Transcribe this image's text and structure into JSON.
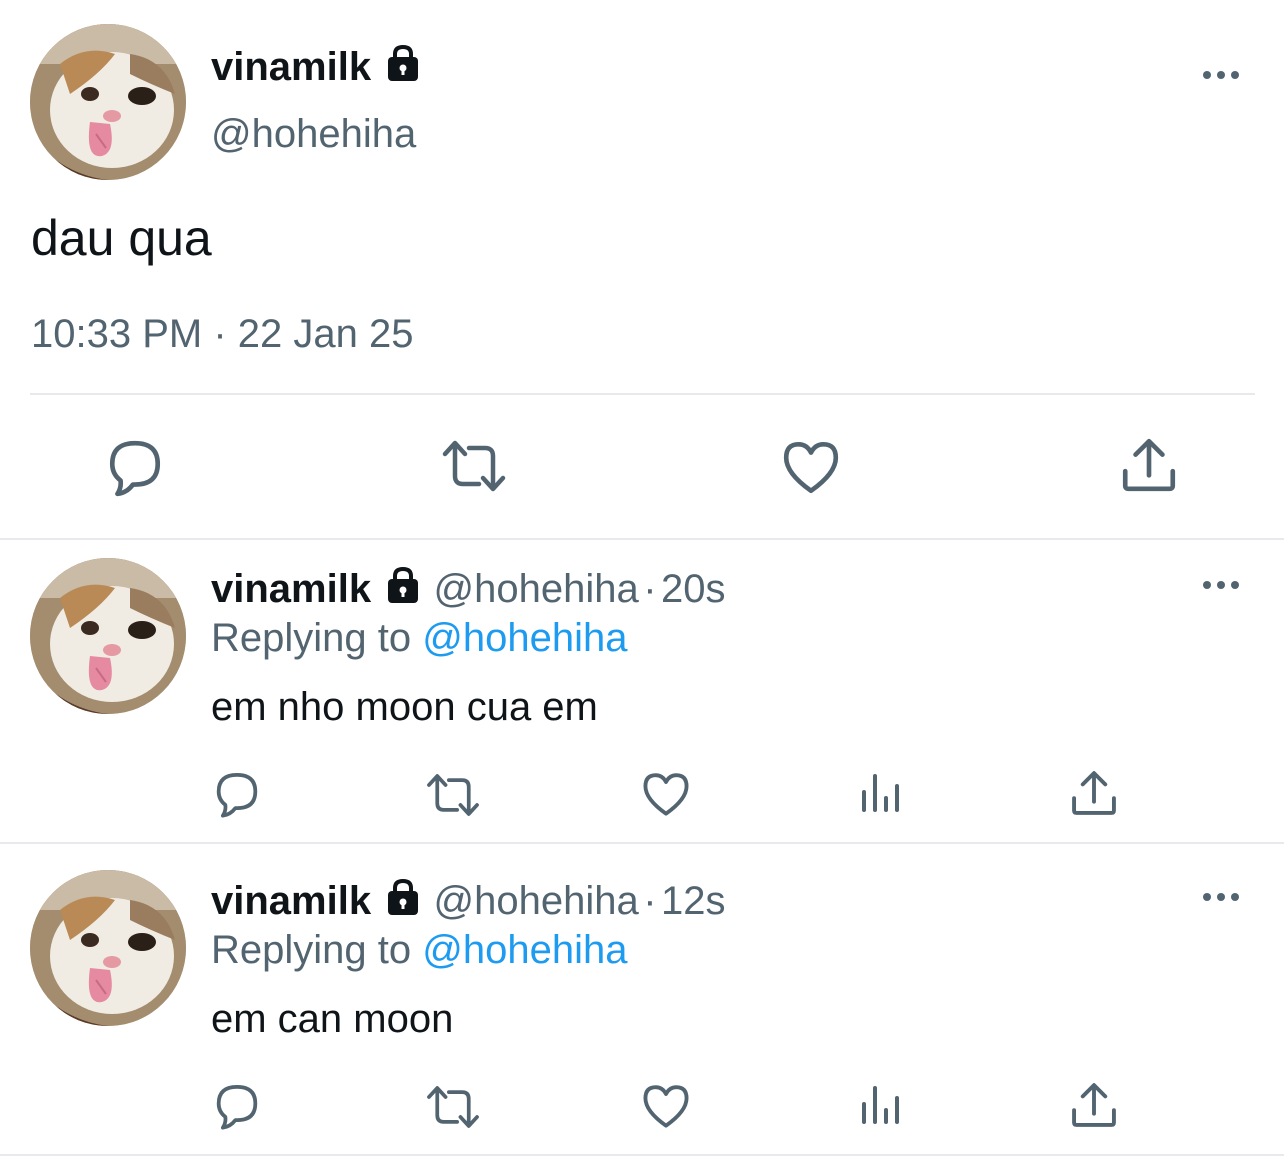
{
  "main_tweet": {
    "display_name": "vinamilk",
    "handle": "@hohehiha",
    "text": "dau qua",
    "timestamp": "10:33 PM",
    "date": "22 Jan 25",
    "separator": "·"
  },
  "replies": [
    {
      "display_name": "vinamilk",
      "handle": "@hohehiha",
      "separator": "·",
      "time_ago": "20s",
      "replying_label": "Replying to",
      "replying_handle": "@hohehiha",
      "text": "em nho moon cua em"
    },
    {
      "display_name": "vinamilk",
      "handle": "@hohehiha",
      "separator": "·",
      "time_ago": "12s",
      "replying_label": "Replying to",
      "replying_handle": "@hohehiha",
      "text": "em can moon"
    }
  ],
  "icons": {
    "lock": "lock-icon",
    "more": "more-icon",
    "reply": "reply-icon",
    "retweet": "retweet-icon",
    "like": "like-icon",
    "views": "views-icon",
    "share": "share-icon"
  },
  "colors": {
    "text": "#0f1419",
    "secondary": "#536471",
    "link": "#1d9bf0",
    "divider": "#e7e9ec"
  }
}
